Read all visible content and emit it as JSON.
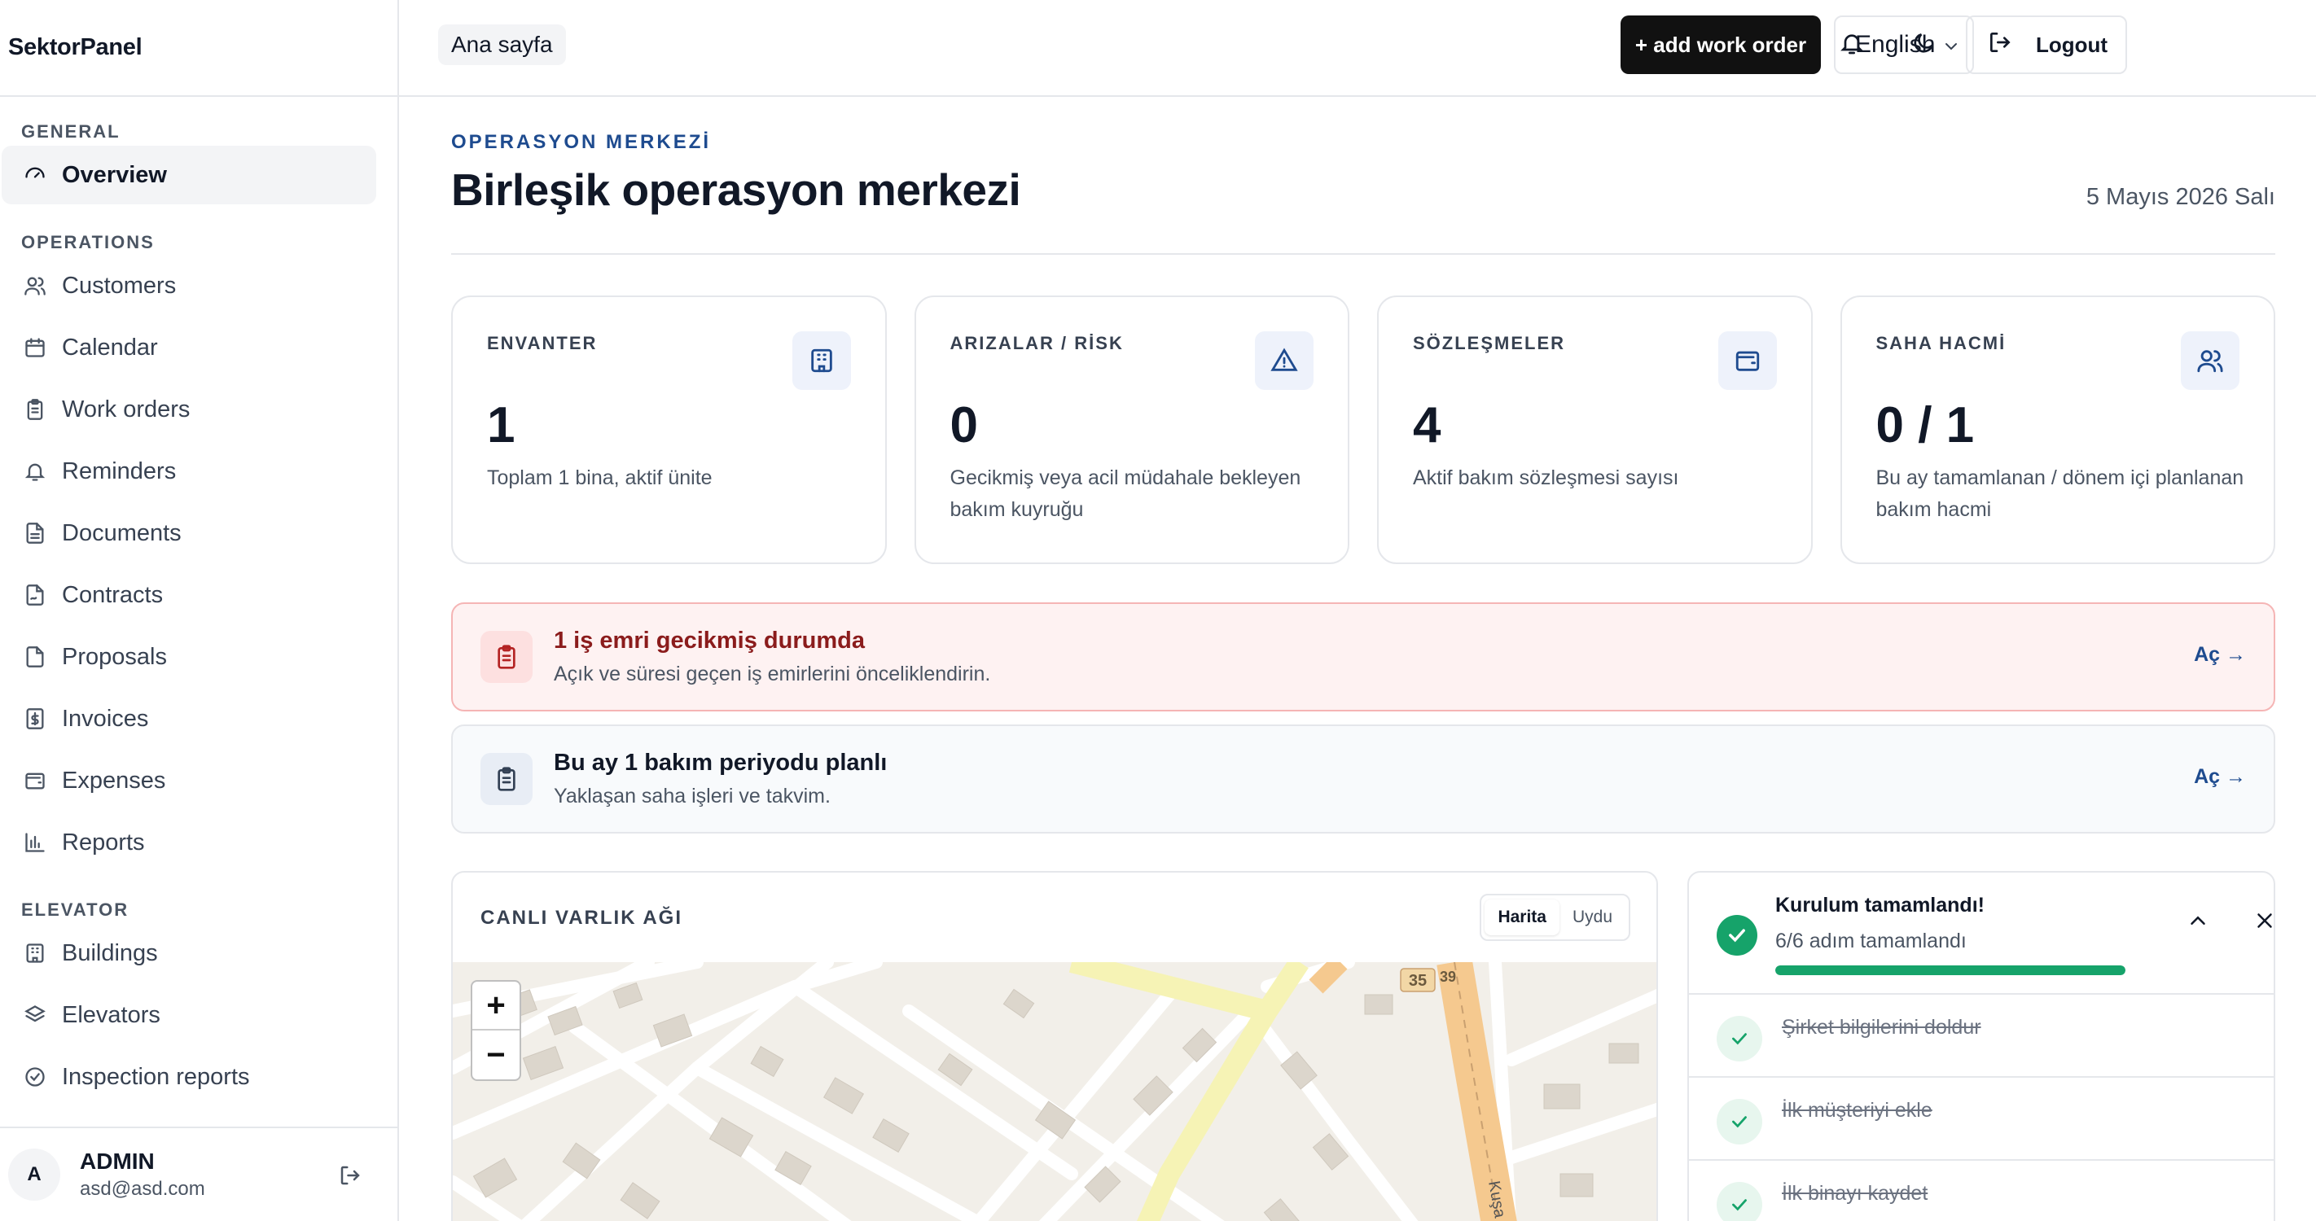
{
  "app": {
    "brand": "SektorPanel"
  },
  "sidebar": {
    "sections": [
      {
        "title": "GENERAL",
        "items": [
          {
            "label": "Overview",
            "icon": "gauge-icon",
            "active": true
          }
        ]
      },
      {
        "title": "OPERATIONS",
        "items": [
          {
            "label": "Customers",
            "icon": "users-icon"
          },
          {
            "label": "Calendar",
            "icon": "calendar-icon"
          },
          {
            "label": "Work orders",
            "icon": "clipboard-icon"
          },
          {
            "label": "Reminders",
            "icon": "bell-icon"
          },
          {
            "label": "Documents",
            "icon": "file-icon"
          },
          {
            "label": "Contracts",
            "icon": "file-signature-icon"
          },
          {
            "label": "Proposals",
            "icon": "file-text-icon"
          },
          {
            "label": "Invoices",
            "icon": "file-dollar-icon"
          },
          {
            "label": "Expenses",
            "icon": "wallet-icon"
          },
          {
            "label": "Reports",
            "icon": "bar-chart-icon"
          }
        ]
      },
      {
        "title": "ELEVATOR",
        "items": [
          {
            "label": "Buildings",
            "icon": "building-icon"
          },
          {
            "label": "Elevators",
            "icon": "layers-icon"
          },
          {
            "label": "Inspection reports",
            "icon": "check-circle-icon"
          }
        ]
      }
    ],
    "user": {
      "initial": "A",
      "name": "ADMIN",
      "email": "asd@asd.com"
    }
  },
  "topbar": {
    "breadcrumb": "Ana sayfa",
    "add_label": "+ add work order",
    "language": "English",
    "logout_label": "Logout"
  },
  "header": {
    "eyebrow": "OPERASYON MERKEZİ",
    "title": "Birleşik operasyon merkezi",
    "date": "5 Mayıs 2026 Salı"
  },
  "kpis": [
    {
      "label": "ENVANTER",
      "value": "1",
      "desc": "Toplam 1 bina, aktif ünite",
      "icon": "building-icon"
    },
    {
      "label": "ARIZALAR / RİSK",
      "value": "0",
      "desc": "Gecikmiş veya acil müdahale bekleyen bakım kuyruğu",
      "icon": "warning-icon"
    },
    {
      "label": "SÖZLEŞMELER",
      "value": "4",
      "desc": "Aktif bakım sözleşmesi sayısı",
      "icon": "wallet-icon"
    },
    {
      "label": "SAHA HACMİ",
      "value": "0 / 1",
      "desc": "Bu ay tamamlanan / dönem içi planlanan bakım hacmi",
      "icon": "users-icon"
    }
  ],
  "alerts": [
    {
      "title": "1 iş emri gecikmiş durumda",
      "sub": "Açık ve süresi geçen iş emirlerini önceliklendirin.",
      "link": "Aç →"
    },
    {
      "title": "Bu ay 1 bakım periyodu planlı",
      "sub": "Yaklaşan saha işleri ve takvim.",
      "link": "Aç →"
    }
  ],
  "map": {
    "title": "CANLI VARLIK AĞI",
    "toggle": [
      "Harita",
      "Uydu"
    ],
    "selected": "Harita",
    "road_labels": [
      "35",
      "39",
      "Kuşa"
    ],
    "zoom_in": "+",
    "zoom_out": "−"
  },
  "setup": {
    "title": "Kurulum tamamlandı!",
    "progress_text": "6/6 adım tamamlandı",
    "progress": 1.0,
    "steps": [
      "Şirket bilgilerini doldur",
      "İlk müşteriyi ekle",
      "İlk binayı kaydet"
    ]
  },
  "colors": {
    "accent": "#1e4b8f",
    "success": "#16a36a",
    "danger_bg": "#fef2f2",
    "danger_text": "#8b1c1c"
  }
}
